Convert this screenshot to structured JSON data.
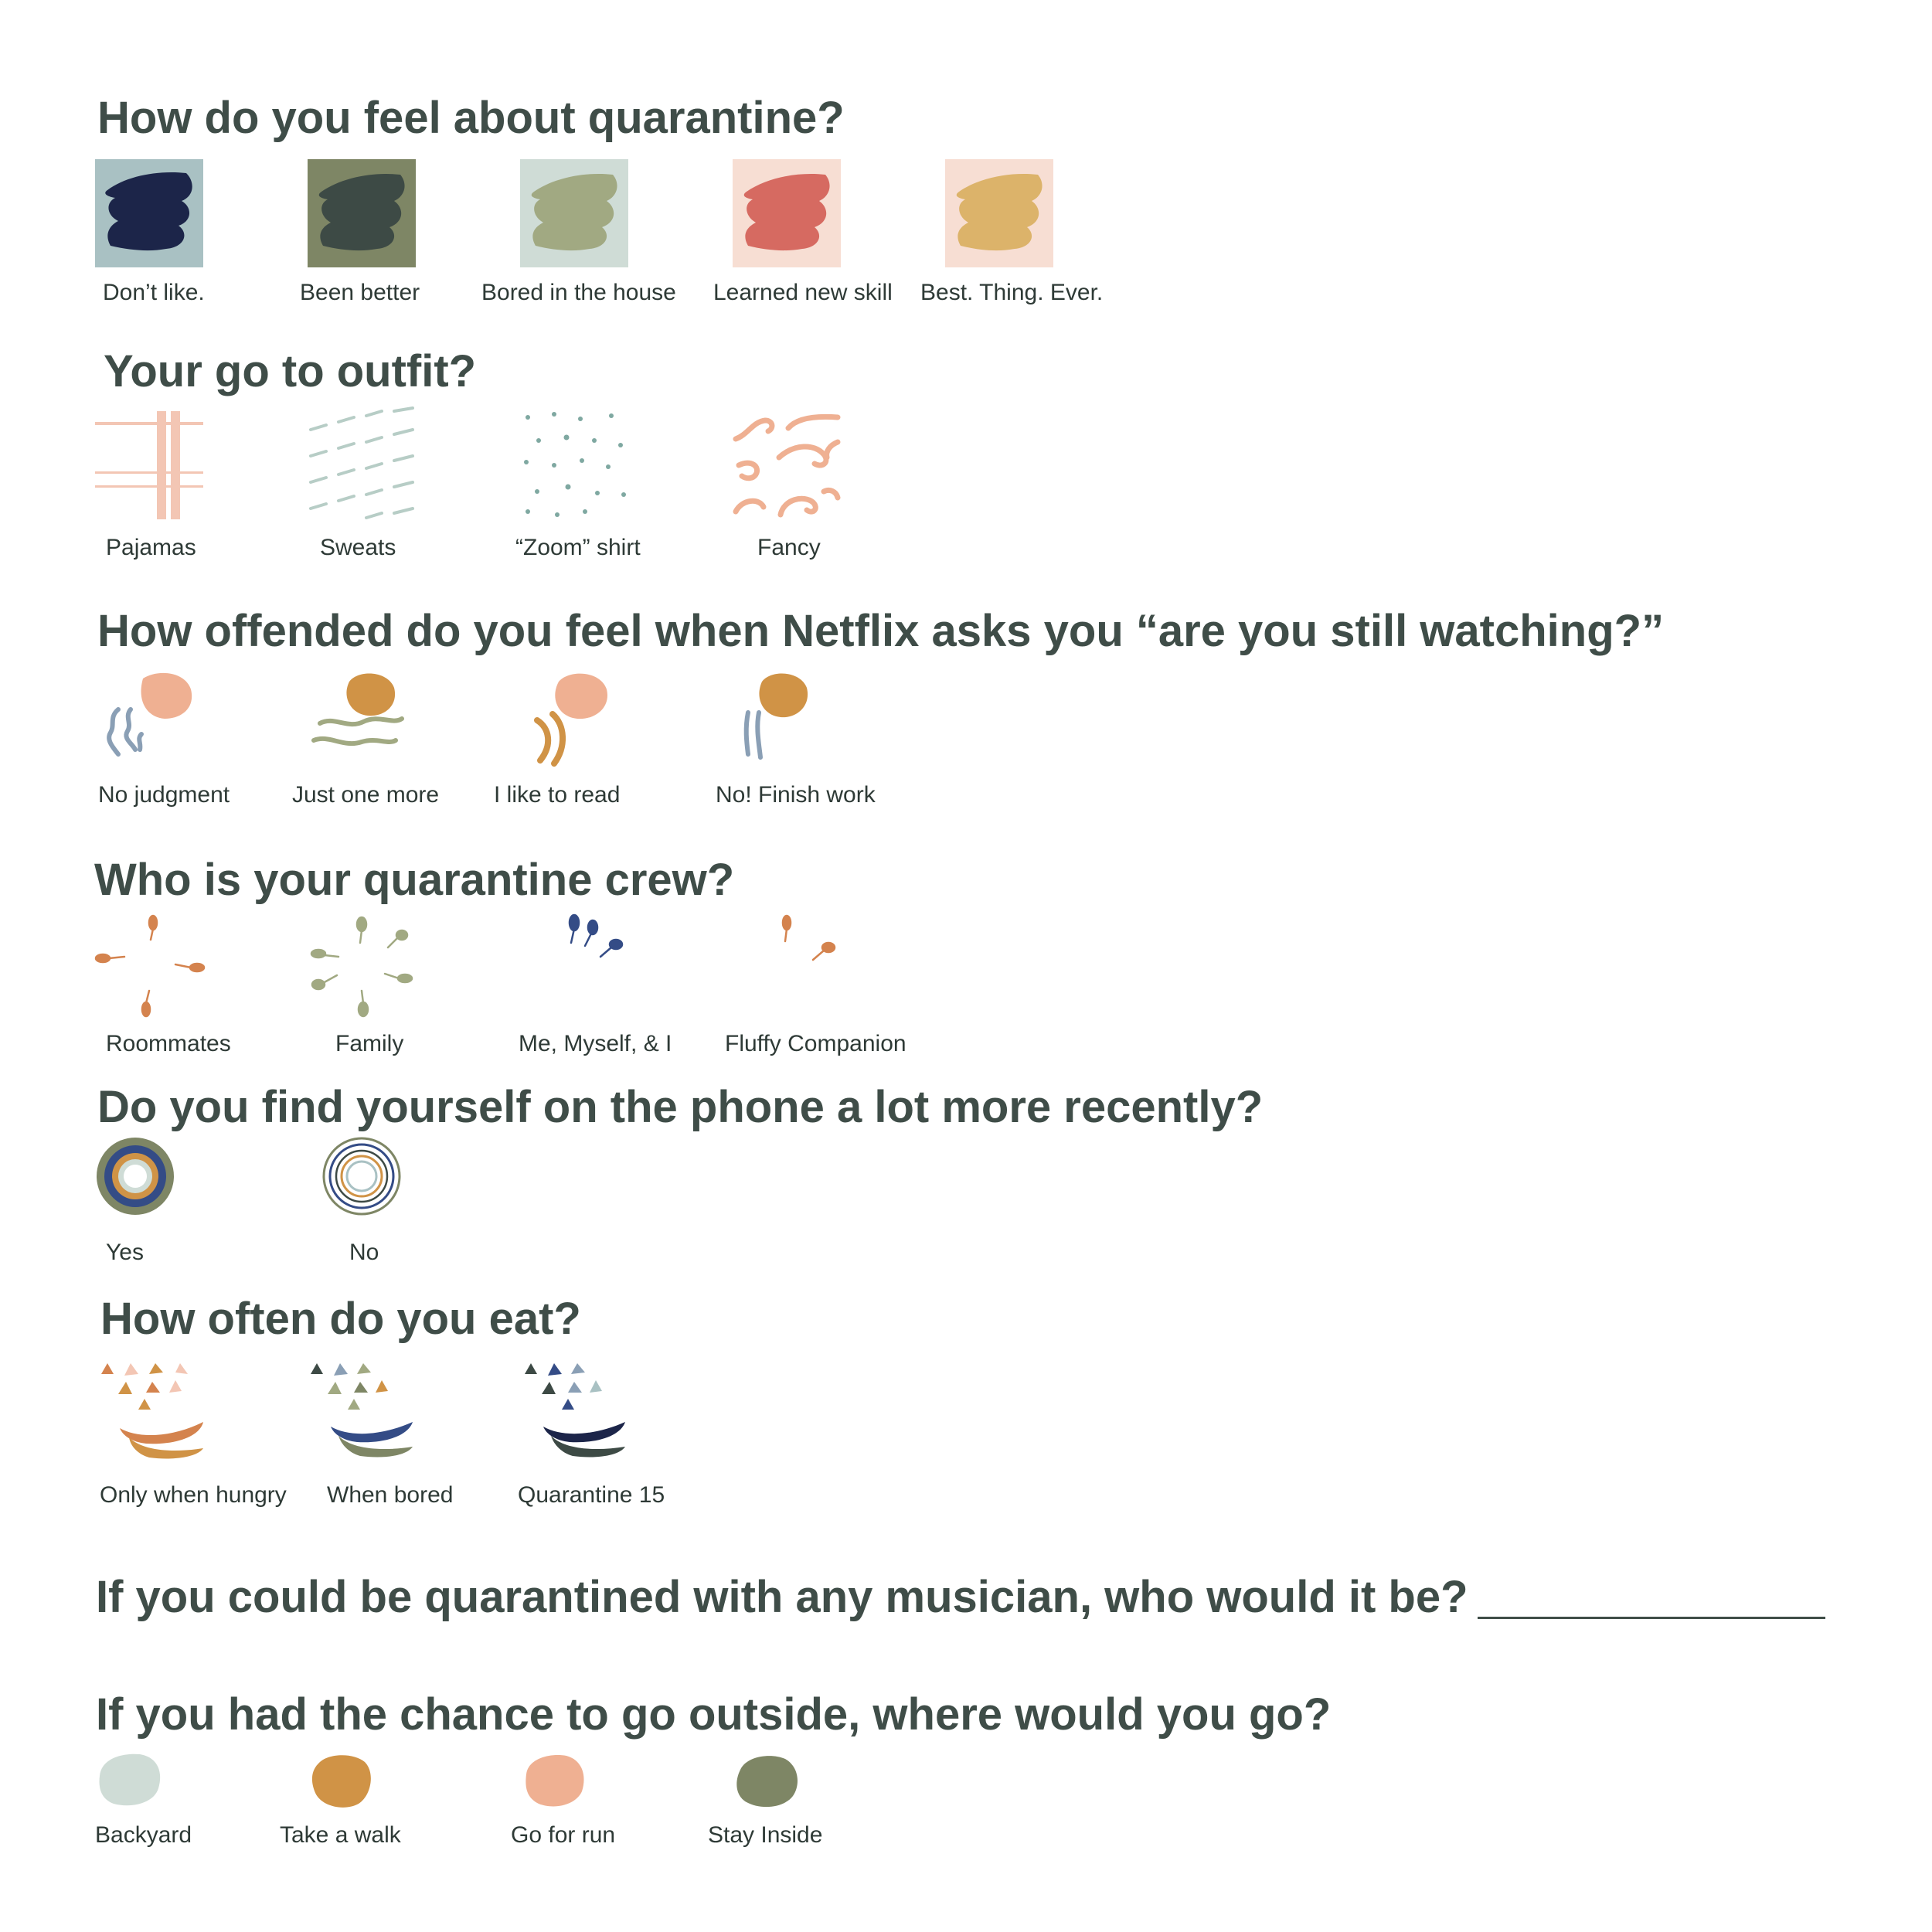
{
  "colors": {
    "heading": "#3f4d48",
    "navy": "#1c2549",
    "forest": "#3d4a45",
    "sage": "#a1a982",
    "coral": "#d66a61",
    "mustard": "#dcb36a",
    "peach": "#efb092",
    "ochre": "#d09346",
    "slate_blue": "#8a9fb5",
    "olive": "#7e8665",
    "mint": "#cfdcd6",
    "pale_blue": "#a9c1c3",
    "blush": "#f7ded3"
  },
  "q1": {
    "title": "How do you feel about quarantine?",
    "options": [
      {
        "label": "Don’t like.",
        "icon": "navy-brushstroke-swatch-icon"
      },
      {
        "label": "Been better",
        "icon": "forest-brushstroke-swatch-icon"
      },
      {
        "label": "Bored in the house",
        "icon": "sage-brushstroke-swatch-icon"
      },
      {
        "label": "Learned new skill",
        "icon": "coral-brushstroke-swatch-icon"
      },
      {
        "label": "Best. Thing. Ever.",
        "icon": "mustard-brushstroke-swatch-icon"
      }
    ]
  },
  "q2": {
    "title": "Your go to outfit?",
    "options": [
      {
        "label": "Pajamas",
        "icon": "plaid-pattern-icon"
      },
      {
        "label": "Sweats",
        "icon": "dash-pattern-icon"
      },
      {
        "label": "“Zoom” shirt",
        "icon": "dot-pattern-icon"
      },
      {
        "label": "Fancy",
        "icon": "swirl-pattern-icon"
      }
    ]
  },
  "q3": {
    "title": "How offended do you feel when Netflix asks you “are you still watching?”",
    "options": [
      {
        "label": "No judgment",
        "icon": "sun-squiggle-icon"
      },
      {
        "label": "Just one more",
        "icon": "sun-wave-icon"
      },
      {
        "label": "I like to read",
        "icon": "sun-arc-icon"
      },
      {
        "label": "No! Finish work",
        "icon": "sun-lines-icon"
      }
    ]
  },
  "q4": {
    "title": "Who is your quarantine crew?",
    "options": [
      {
        "label": "Roommates",
        "icon": "four-seeds-orange-icon"
      },
      {
        "label": "Family",
        "icon": "six-seeds-sage-icon"
      },
      {
        "label": "Me, Myself, & I",
        "icon": "three-seeds-navy-icon"
      },
      {
        "label": "Fluffy Companion",
        "icon": "two-seeds-orange-icon"
      }
    ]
  },
  "q5": {
    "title": "Do you find yourself on the phone a lot more recently?",
    "options": [
      {
        "label": "Yes",
        "icon": "filled-rings-icon"
      },
      {
        "label": "No",
        "icon": "outline-rings-icon"
      }
    ]
  },
  "q6": {
    "title": "How often do you eat?",
    "options": [
      {
        "label": "Only when hungry",
        "icon": "warm-food-face-icon"
      },
      {
        "label": "When bored",
        "icon": "green-food-face-icon"
      },
      {
        "label": "Quarantine 15",
        "icon": "blue-food-face-icon"
      }
    ]
  },
  "q7": {
    "title": "If you could be quarantined with any musician, who would it be?"
  },
  "q8": {
    "title": "If you had the chance to go outside, where would you go?",
    "options": [
      {
        "label": "Backyard",
        "icon": "mint-blob-icon"
      },
      {
        "label": "Take a walk",
        "icon": "ochre-blob-icon"
      },
      {
        "label": "Go for run",
        "icon": "peach-blob-icon"
      },
      {
        "label": "Stay Inside",
        "icon": "olive-blob-icon"
      }
    ]
  }
}
